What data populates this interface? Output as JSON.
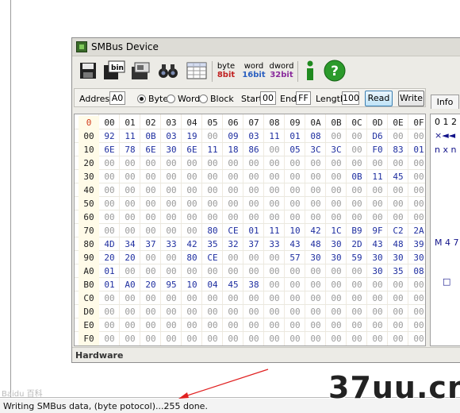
{
  "window": {
    "title": "SMBus Device"
  },
  "toolbar": {
    "items": [
      {
        "name": "save-icon",
        "label": ""
      },
      {
        "name": "bin-icon",
        "label": "bin"
      },
      {
        "name": "chip-icon",
        "label": ""
      },
      {
        "name": "binoculars-icon",
        "label": ""
      },
      {
        "name": "table-icon",
        "label": ""
      },
      {
        "name": "byte-view",
        "label": "byte",
        "sub": "8bit"
      },
      {
        "name": "word-view",
        "label": "word",
        "sub": "16bit"
      },
      {
        "name": "dword-view",
        "label": "dword",
        "sub": "32bit"
      },
      {
        "name": "info-icon",
        "label": "i"
      },
      {
        "name": "help-icon",
        "label": "?"
      }
    ]
  },
  "controls": {
    "address_label": "Address",
    "address_value": "A0",
    "mode_byte": "Byte",
    "mode_word": "Word",
    "mode_block": "Block",
    "mode_selected": "Byte",
    "start_label": "Start",
    "start_value": "00",
    "end_label": "End",
    "end_value": "FF",
    "length_label": "Length",
    "length_value": "100",
    "read_button": "Read",
    "write_button": "Write",
    "info_tab": "Info"
  },
  "hex_grid": {
    "corner": "0",
    "columns": [
      "00",
      "01",
      "02",
      "03",
      "04",
      "05",
      "06",
      "07",
      "08",
      "09",
      "0A",
      "0B",
      "0C",
      "0D",
      "0E",
      "0F"
    ],
    "rows": [
      {
        "addr": "00",
        "cells": [
          "92",
          "11",
          "0B",
          "03",
          "19",
          "00",
          "09",
          "03",
          "11",
          "01",
          "08",
          "00",
          "00",
          "D6",
          "00",
          "00"
        ]
      },
      {
        "addr": "10",
        "cells": [
          "6E",
          "78",
          "6E",
          "30",
          "6E",
          "11",
          "18",
          "86",
          "00",
          "05",
          "3C",
          "3C",
          "00",
          "F0",
          "83",
          "01"
        ]
      },
      {
        "addr": "20",
        "cells": [
          "00",
          "00",
          "00",
          "00",
          "00",
          "00",
          "00",
          "00",
          "00",
          "00",
          "00",
          "00",
          "00",
          "00",
          "00",
          "00"
        ]
      },
      {
        "addr": "30",
        "cells": [
          "00",
          "00",
          "00",
          "00",
          "00",
          "00",
          "00",
          "00",
          "00",
          "00",
          "00",
          "00",
          "0B",
          "11",
          "45",
          "00"
        ]
      },
      {
        "addr": "40",
        "cells": [
          "00",
          "00",
          "00",
          "00",
          "00",
          "00",
          "00",
          "00",
          "00",
          "00",
          "00",
          "00",
          "00",
          "00",
          "00",
          "00"
        ]
      },
      {
        "addr": "50",
        "cells": [
          "00",
          "00",
          "00",
          "00",
          "00",
          "00",
          "00",
          "00",
          "00",
          "00",
          "00",
          "00",
          "00",
          "00",
          "00",
          "00"
        ]
      },
      {
        "addr": "60",
        "cells": [
          "00",
          "00",
          "00",
          "00",
          "00",
          "00",
          "00",
          "00",
          "00",
          "00",
          "00",
          "00",
          "00",
          "00",
          "00",
          "00"
        ]
      },
      {
        "addr": "70",
        "cells": [
          "00",
          "00",
          "00",
          "00",
          "00",
          "80",
          "CE",
          "01",
          "11",
          "10",
          "42",
          "1C",
          "B9",
          "9F",
          "C2",
          "2A"
        ]
      },
      {
        "addr": "80",
        "cells": [
          "4D",
          "34",
          "37",
          "33",
          "42",
          "35",
          "32",
          "37",
          "33",
          "43",
          "48",
          "30",
          "2D",
          "43",
          "48",
          "39"
        ]
      },
      {
        "addr": "90",
        "cells": [
          "20",
          "20",
          "00",
          "00",
          "80",
          "CE",
          "00",
          "00",
          "00",
          "57",
          "30",
          "30",
          "59",
          "30",
          "30",
          "30"
        ]
      },
      {
        "addr": "A0",
        "cells": [
          "01",
          "00",
          "00",
          "00",
          "00",
          "00",
          "00",
          "00",
          "00",
          "00",
          "00",
          "00",
          "00",
          "30",
          "35",
          "08"
        ]
      },
      {
        "addr": "B0",
        "cells": [
          "01",
          "A0",
          "20",
          "95",
          "10",
          "04",
          "45",
          "38",
          "00",
          "00",
          "00",
          "00",
          "00",
          "00",
          "00",
          "00"
        ]
      },
      {
        "addr": "C0",
        "cells": [
          "00",
          "00",
          "00",
          "00",
          "00",
          "00",
          "00",
          "00",
          "00",
          "00",
          "00",
          "00",
          "00",
          "00",
          "00",
          "00"
        ]
      },
      {
        "addr": "D0",
        "cells": [
          "00",
          "00",
          "00",
          "00",
          "00",
          "00",
          "00",
          "00",
          "00",
          "00",
          "00",
          "00",
          "00",
          "00",
          "00",
          "00"
        ]
      },
      {
        "addr": "E0",
        "cells": [
          "00",
          "00",
          "00",
          "00",
          "00",
          "00",
          "00",
          "00",
          "00",
          "00",
          "00",
          "00",
          "00",
          "00",
          "00",
          "00"
        ]
      },
      {
        "addr": "F0",
        "cells": [
          "00",
          "00",
          "00",
          "00",
          "00",
          "00",
          "00",
          "00",
          "00",
          "00",
          "00",
          "00",
          "00",
          "00",
          "00",
          "00"
        ]
      }
    ]
  },
  "info_panel": {
    "header": "0 1 2",
    "row00": "×◄◄",
    "row10": "n x n",
    "row80": "M 4 7",
    "rowB0": "□"
  },
  "hardware": {
    "label": "Hardware"
  },
  "status": {
    "text": "Writing SMBus data, (byte potocol)...255 done."
  },
  "watermarks": {
    "left": "Baidu 百科",
    "right": "37uu.cn"
  },
  "colors": {
    "nonzero": "#1f2fa0",
    "zero": "#9b9b9b",
    "corner": "#d23a1a",
    "arrow": "#e02020"
  }
}
